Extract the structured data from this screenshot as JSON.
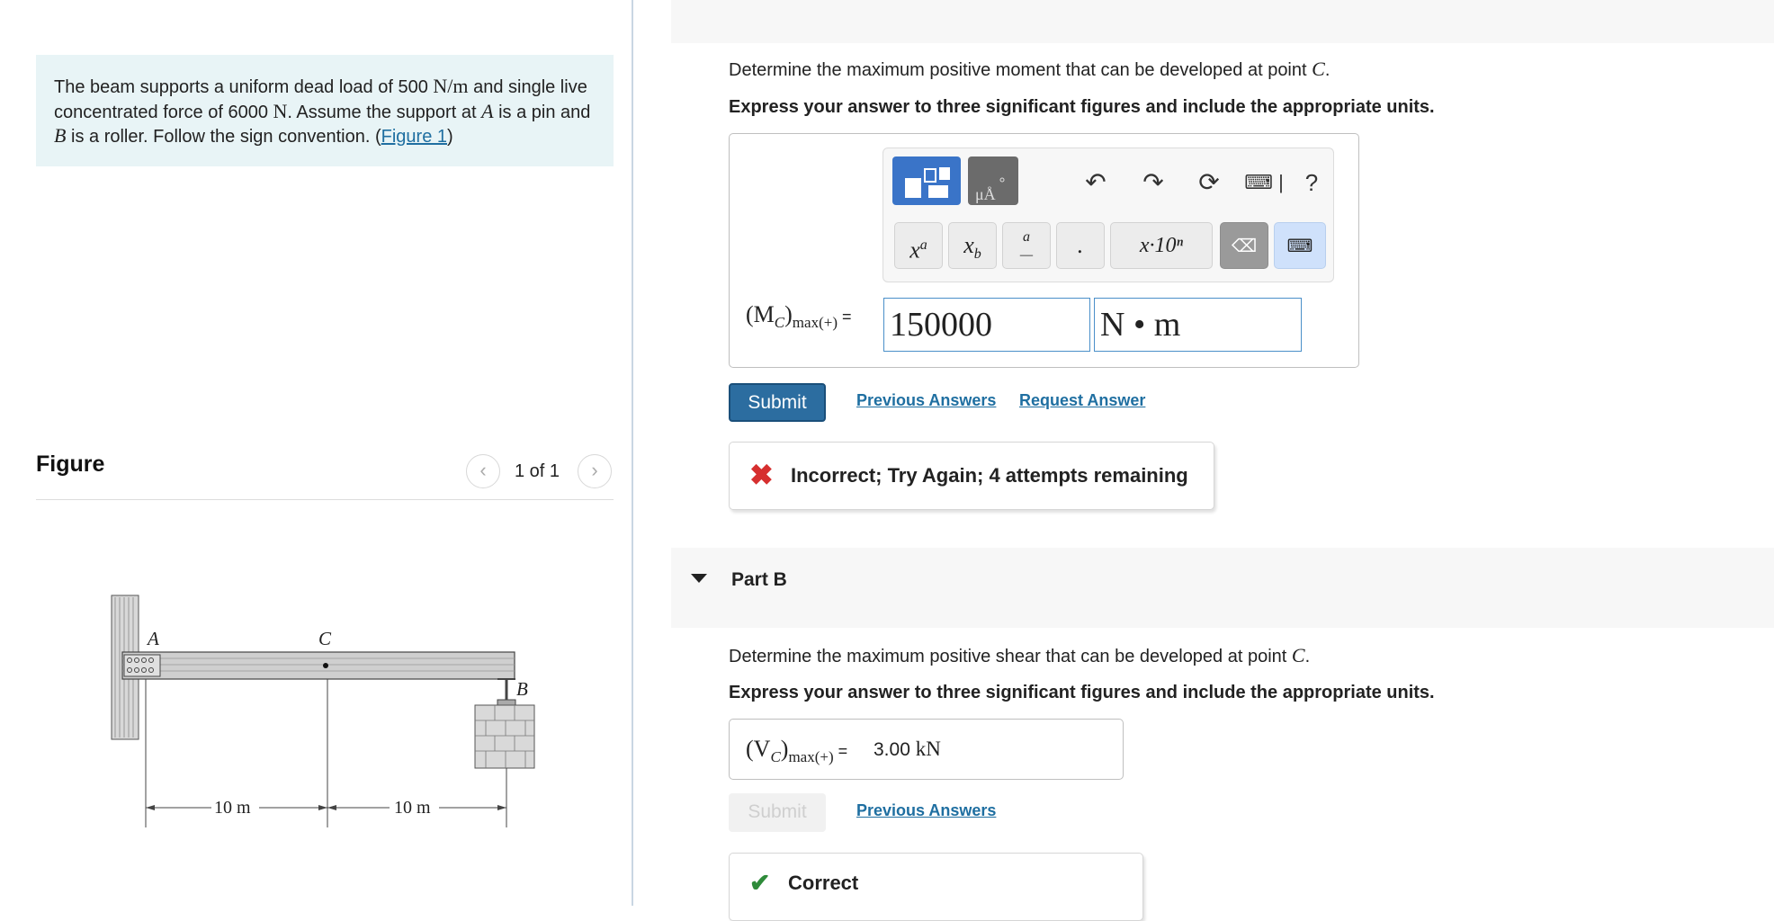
{
  "problem": {
    "text_1": "The beam supports a uniform dead load of 500 ",
    "unit_load": "N/m",
    "text_2": " and single live concentrated force of 6000 ",
    "unit_force": "N",
    "text_3": ". Assume the support at ",
    "point_a": "A",
    "text_4": " is a pin and ",
    "point_b": "B",
    "text_5": " is a roller. Follow the sign convention. (",
    "figure_link": "Figure 1",
    "text_6": ")"
  },
  "figure": {
    "title": "Figure",
    "pager": "1 of 1",
    "prev_icon": "chevron-left-icon",
    "next_icon": "chevron-right-icon",
    "labels": {
      "a": "A",
      "c": "C",
      "b": "B"
    },
    "dimensions": [
      "10 m",
      "10 m"
    ]
  },
  "part_a": {
    "question_1": "Determine the maximum positive moment that can be developed at point ",
    "point": "C",
    "question_2": ".",
    "instruction": "Express your answer to three significant figures and include the appropriate units.",
    "toolbar": {
      "undo_icon": "undo-icon",
      "redo_icon": "redo-icon",
      "reset_icon": "reset-icon",
      "keyboard_icon": "keyboard-icon",
      "help": "?",
      "keys": [
        "x^a",
        "x_b",
        "a/b",
        ".",
        "x·10ⁿ"
      ]
    },
    "label_main": "(M",
    "label_sub_c": "C",
    "label_close": ")",
    "label_sub": "max(+)",
    "eq": " =",
    "value": "150000",
    "units": "N • m",
    "submit": "Submit",
    "previous_answers": "Previous Answers",
    "request_answer": "Request Answer",
    "feedback": "Incorrect; Try Again; 4 attempts remaining"
  },
  "part_b": {
    "title": "Part B",
    "question_1": "Determine the maximum positive shear that can be developed at point ",
    "point": "C",
    "question_2": ".",
    "instruction": "Express your answer to three significant figures and include the appropriate units.",
    "label_main": "(V",
    "label_sub_c": "C",
    "label_close": ")",
    "label_sub": "max(+)",
    "eq": " =",
    "value": "3.00 ",
    "unit": "kN",
    "submit": "Submit",
    "previous_answers": "Previous Answers",
    "feedback": "Correct"
  },
  "colors": {
    "accent": "#2c6da0",
    "link": "#1f6fa1",
    "incorrect": "#d62f2f",
    "correct": "#2e8b3a",
    "problem_bg": "#e8f4f6"
  }
}
